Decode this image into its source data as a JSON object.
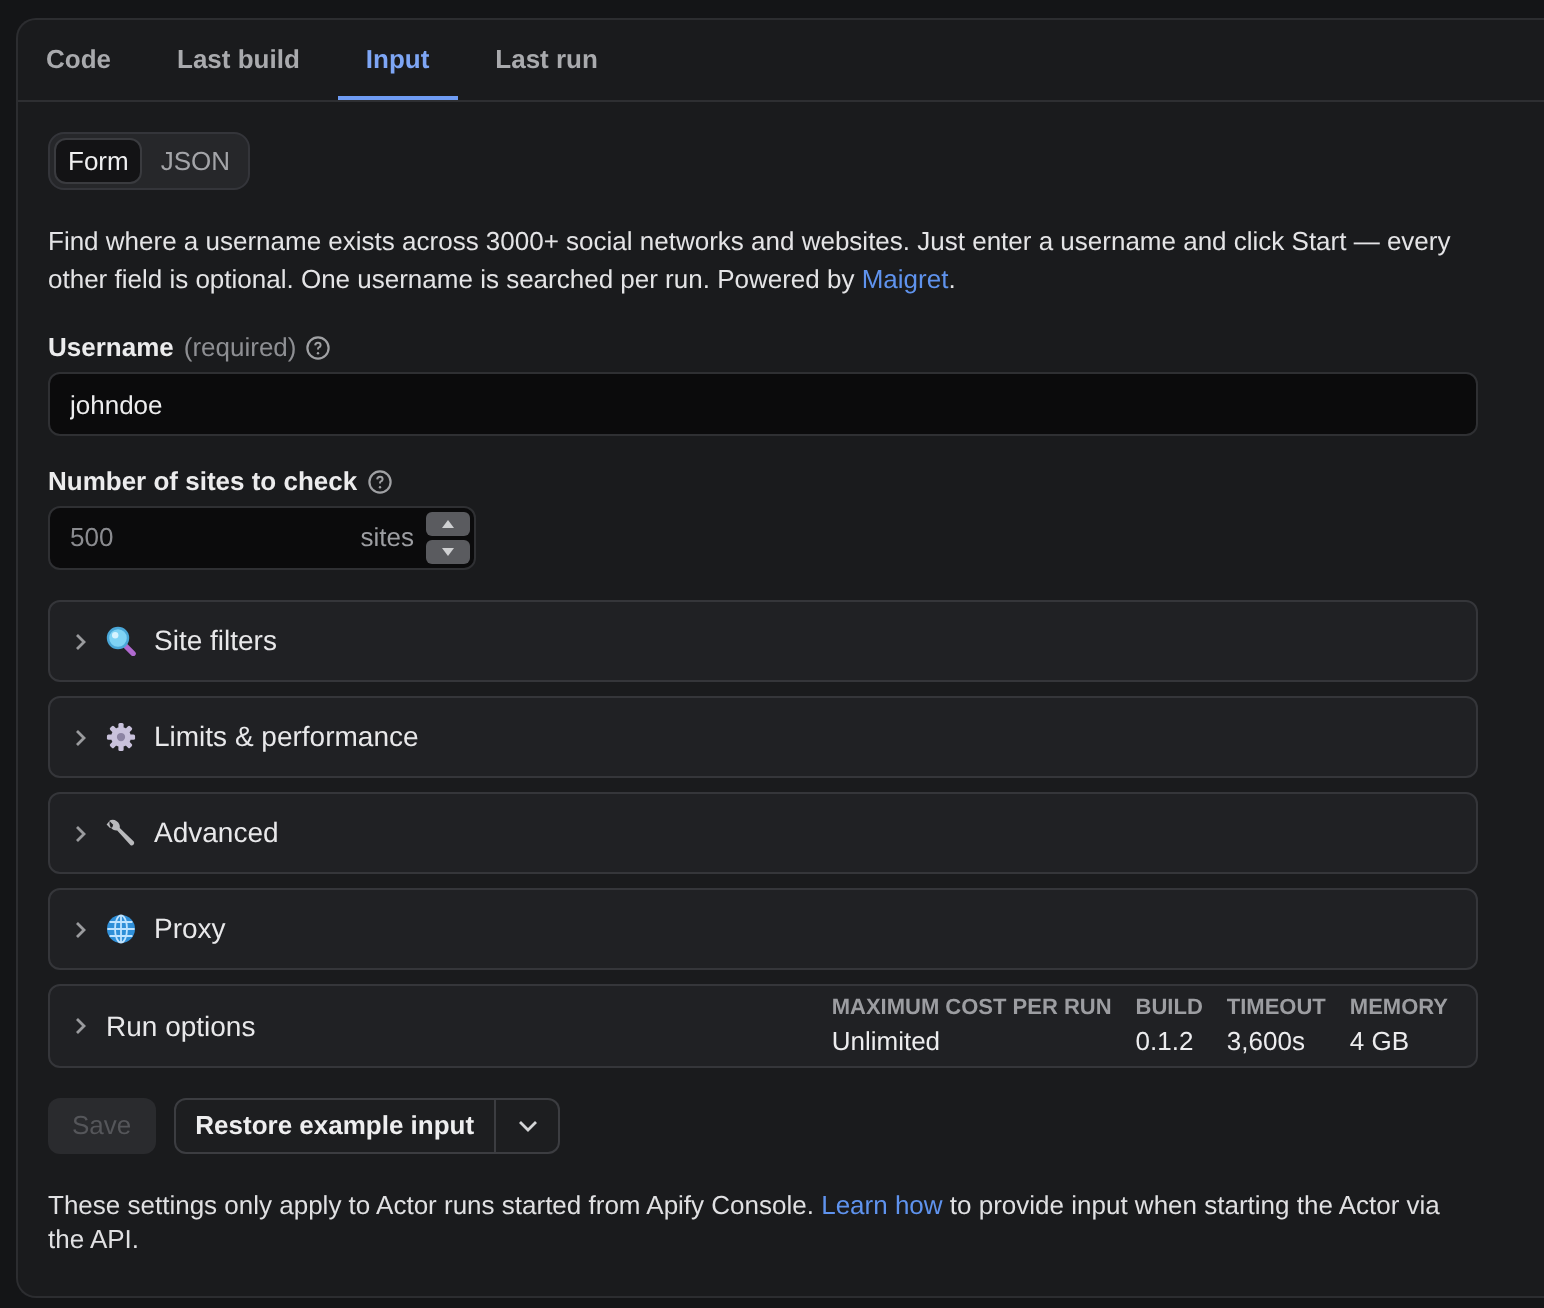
{
  "tabs": [
    {
      "label": "Code",
      "selected": false
    },
    {
      "label": "Last build",
      "selected": false
    },
    {
      "label": "Input",
      "selected": true
    },
    {
      "label": "Last run",
      "selected": false
    }
  ],
  "view_toggle": [
    {
      "label": "Form",
      "selected": true
    },
    {
      "label": "JSON",
      "selected": false
    }
  ],
  "description": {
    "text": "Find where a username exists across 3000+ social networks and websites. Just enter a username and click Start — every other field is optional. One username is searched per run. Powered by ",
    "link": "Maigret",
    "after": "."
  },
  "fields": [
    {
      "kind": "text",
      "label": "Username",
      "hint": "(required)",
      "help": true,
      "value": "johndoe"
    },
    {
      "kind": "number",
      "label": "Number of sites to check",
      "help": true,
      "placeholder": "500",
      "unit": "sites"
    }
  ],
  "sections": [
    {
      "title": "Site filters",
      "expanded": false
    },
    {
      "title": "Limits & performance",
      "expanded": false
    },
    {
      "title": "Advanced",
      "expanded": false
    },
    {
      "title": "Proxy",
      "expanded": false
    }
  ],
  "run_options": {
    "title": "Run options",
    "expanded": false,
    "stats": [
      {
        "label": "MAXIMUM COST PER RUN",
        "value": "Unlimited"
      },
      {
        "label": "BUILD",
        "value": "0.1.2"
      },
      {
        "label": "TIMEOUT",
        "value": "3,600s"
      },
      {
        "label": "MEMORY",
        "value": "4 GB"
      }
    ]
  },
  "buttons": {
    "save": {
      "label": "Save",
      "disabled": true
    },
    "restore": {
      "label": "Restore example input"
    }
  },
  "footer": {
    "text": "These settings only apply to Actor runs started from Apify Console. ",
    "link": "Learn how",
    "after": " to provide input when starting the Actor via the API."
  }
}
